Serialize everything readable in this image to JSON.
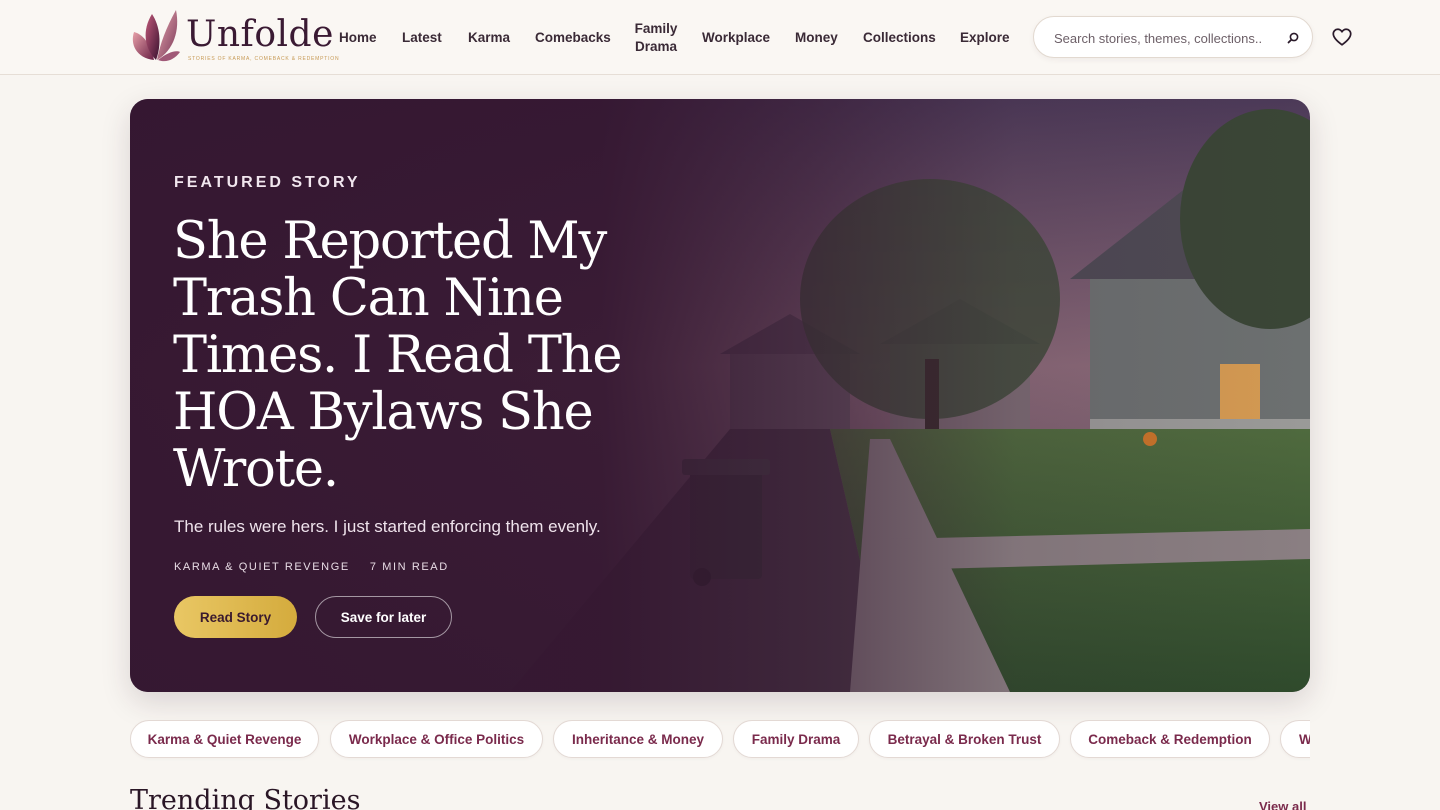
{
  "brand": {
    "name": "Unfolde",
    "tagline": "STORIES OF KARMA, COMEBACK & REDEMPTION",
    "colors": {
      "plum": "#3a1a33",
      "gold": "#d9b24a",
      "accent": "#7a2a4c"
    }
  },
  "nav": {
    "items": [
      {
        "label": "Home"
      },
      {
        "label": "Latest"
      },
      {
        "label": "Karma"
      },
      {
        "label": "Comebacks"
      },
      {
        "label": "Family Drama"
      },
      {
        "label": "Workplace"
      },
      {
        "label": "Money"
      },
      {
        "label": "Collections"
      },
      {
        "label": "Explore"
      }
    ]
  },
  "search": {
    "placeholder": "Search stories, themes, collections..",
    "value": ""
  },
  "icons": {
    "search": "search-icon",
    "favorites": "heart-icon",
    "logo": "butterfly-logo-icon"
  },
  "hero": {
    "eyebrow": "FEATURED STORY",
    "title": "She Reported My Trash Can Nine Times. I Read The HOA Bylaws She Wrote.",
    "subtitle": "The rules were hers. I just started enforcing them evenly.",
    "category": "KARMA & QUIET REVENGE",
    "read_time": "7 MIN READ",
    "primary_button": "Read Story",
    "secondary_button": "Save for later"
  },
  "categories": [
    "Karma & Quiet Revenge",
    "Workplace & Office Politics",
    "Inheritance & Money",
    "Family Drama",
    "Betrayal & Broken Trust",
    "Comeback & Redemption",
    "W"
  ],
  "trending": {
    "title": "Trending Stories",
    "view_all": "View all"
  }
}
